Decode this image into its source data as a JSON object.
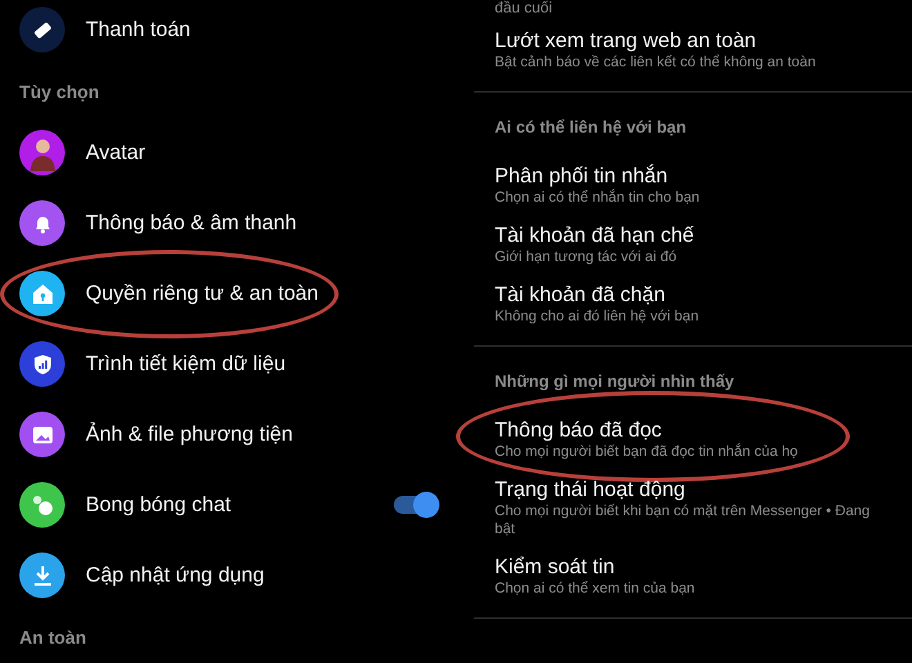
{
  "left": {
    "sections": [
      {
        "items": [
          {
            "label": "Thanh toán",
            "color": "#0c1c3e",
            "kind": "link",
            "highlighted": false
          }
        ]
      },
      {
        "header": "Tùy chọn",
        "items": [
          {
            "label": "Avatar",
            "color": "#b01ee8",
            "kind": "link",
            "highlighted": false
          },
          {
            "label": "Thông báo & âm thanh",
            "color": "#a253f0",
            "kind": "link",
            "highlighted": false
          },
          {
            "label": "Quyền riêng tư & an toàn",
            "color": "#1fb3f2",
            "kind": "link",
            "highlighted": true
          },
          {
            "label": "Trình tiết kiệm dữ liệu",
            "color": "#2d3fd9",
            "kind": "link",
            "highlighted": false
          },
          {
            "label": "Ảnh & file phương tiện",
            "color": "#a14ff0",
            "kind": "link",
            "highlighted": false
          },
          {
            "label": "Bong bóng chat",
            "color": "#3ec54b",
            "kind": "toggle",
            "on": true,
            "highlighted": false
          },
          {
            "label": "Cập nhật ứng dụng",
            "color": "#2aa3ea",
            "kind": "link",
            "highlighted": false
          }
        ]
      },
      {
        "header": "An toàn"
      }
    ]
  },
  "right": {
    "top_text": "đầu cuối",
    "sections": [
      {
        "items": [
          {
            "title": "Lướt xem trang web an toàn",
            "subtitle": "Bật cảnh báo về các liên kết có thể không an toàn",
            "highlighted": false
          }
        ]
      },
      {
        "header": "Ai có thể liên hệ với bạn",
        "items": [
          {
            "title": "Phân phối tin nhắn",
            "subtitle": "Chọn ai có thể nhắn tin cho bạn",
            "highlighted": false
          },
          {
            "title": "Tài khoản đã hạn chế",
            "subtitle": "Giới hạn tương tác với ai đó",
            "highlighted": false
          },
          {
            "title": "Tài khoản đã chặn",
            "subtitle": "Không cho ai đó liên hệ với bạn",
            "highlighted": false
          }
        ]
      },
      {
        "header": "Những gì mọi người nhìn thấy",
        "items": [
          {
            "title": "Thông báo đã đọc",
            "subtitle": "Cho mọi người biết bạn đã đọc tin nhắn của họ",
            "highlighted": true
          },
          {
            "title": "Trạng thái hoạt động",
            "subtitle": "Cho mọi người biết khi bạn có mặt trên Messenger • Đang bật",
            "highlighted": false
          },
          {
            "title": "Kiểm soát tin",
            "subtitle": "Chọn ai có thể xem tin của bạn",
            "highlighted": false
          }
        ]
      }
    ]
  }
}
